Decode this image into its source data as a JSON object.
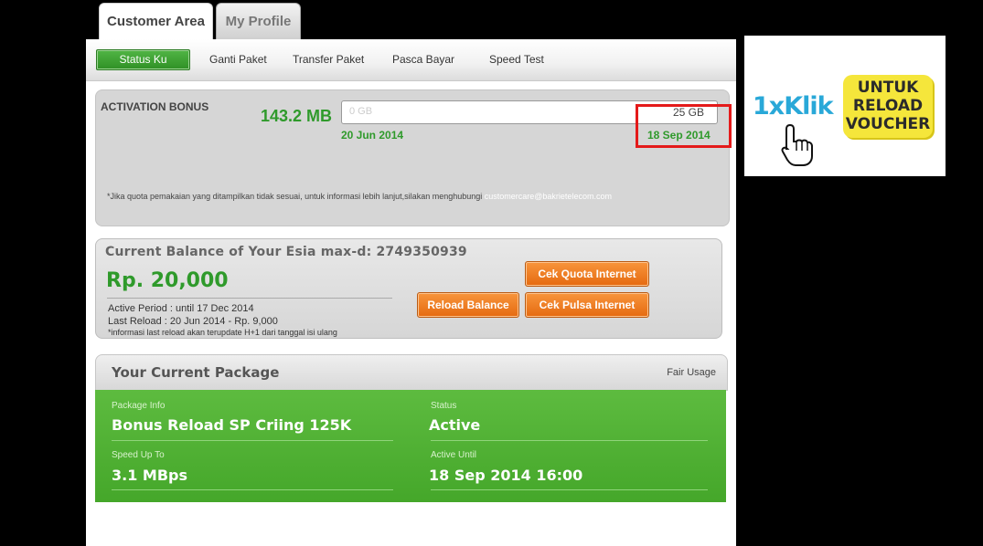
{
  "tabs": [
    {
      "label": "Customer Area",
      "active": true
    },
    {
      "label": "My Profile",
      "active": false
    }
  ],
  "subnav": {
    "items": [
      "Status Ku",
      "Ganti Paket",
      "Transfer Paket",
      "Pasca Bayar",
      "Speed Test"
    ],
    "active_index": 0
  },
  "activation": {
    "title": "ACTIVATION BONUS",
    "amount": "143.2 MB",
    "bar_min": "0 GB",
    "bar_max": "25 GB",
    "start_date": "20 Jun 2014",
    "end_date": "18 Sep 2014",
    "note": "*Jika quota pemakaian yang ditampilkan tidak sesuai, untuk informasi lebih lanjut,silakan menghubungi",
    "email": "customercare@bakrietelecom.com"
  },
  "balance": {
    "title": "Current Balance of Your Esia max-d: 2749350939",
    "amount": "Rp. 20,000",
    "active_period": "Active Period : until 17 Dec 2014",
    "last_reload": "Last Reload : 20 Jun 2014 - Rp. 9,000",
    "note": "*informasi last reload akan terupdate H+1 dari tanggal isi ulang",
    "buttons": {
      "cek_quota": "Cek Quota Internet",
      "reload": "Reload Balance",
      "cek_pulsa": "Cek Pulsa Internet"
    }
  },
  "package": {
    "title": "Your Current Package",
    "fair_usage": "Fair Usage",
    "info_label": "Package Info",
    "info_value": "Bonus Reload SP Criing 125K",
    "status_label": "Status",
    "status_value": "Active",
    "speed_label": "Speed Up To",
    "speed_value": "3.1 MBps",
    "until_label": "Active Until",
    "until_value": "18 Sep 2014 16:00"
  },
  "ad": {
    "brand": "1xKlik",
    "lines": [
      "UNTUK",
      "RELOAD",
      "VOUCHER"
    ],
    "icon": "hand-cursor-icon"
  },
  "colors": {
    "green": "#2f9a2b",
    "orange": "#e56a10",
    "highlight": "#e41a1a",
    "ad_blue": "#29a8d8",
    "ad_yellow": "#f5e63b"
  }
}
